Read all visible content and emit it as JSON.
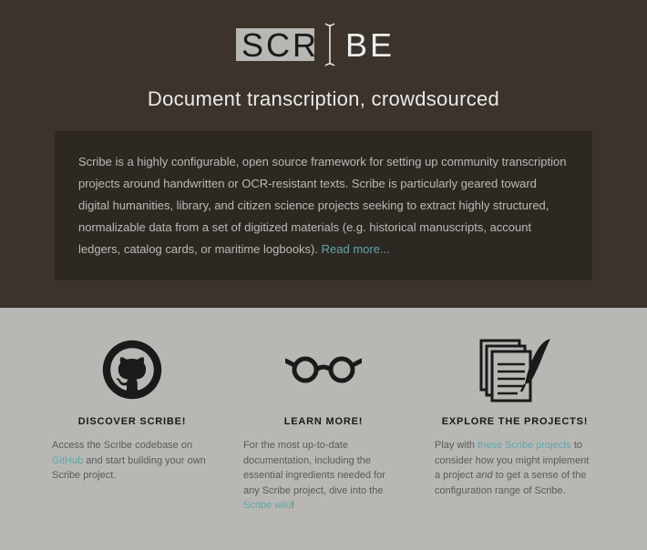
{
  "logo": {
    "text_left": "SCR",
    "text_right": "BE"
  },
  "tagline": "Document transcription, crowdsourced",
  "description": {
    "body": "Scribe is a highly configurable, open source framework for setting up community transcription projects around handwritten or OCR-resistant texts. Scribe is particularly geared toward digital humanities, library, and citizen science projects seeking to extract highly structured, normalizable data from a set of digitized materials (e.g. historical manuscripts, account ledgers, catalog cards, or maritime logbooks).  ",
    "read_more": "Read more..."
  },
  "cards": {
    "discover": {
      "heading": "DISCOVER SCRIBE!",
      "pre": "Access the Scribe codebase on ",
      "link": "GitHub",
      "post": " and start building your own Scribe project."
    },
    "learn": {
      "heading": "LEARN MORE!",
      "pre": "For the most up-to-date documentation, including the essential ingredients needed for any Scribe project, dive into the ",
      "link": "Scribe wiki",
      "post": "!"
    },
    "explore": {
      "heading": "EXPLORE THE PROJECTS!",
      "pre": "Play with ",
      "link": "these Scribe projects",
      "mid": " to consider how you might implement a project ",
      "and": "and",
      "post": " to get a sense of the configuration range of Scribe."
    }
  },
  "colors": {
    "hero_bg": "#3c332c",
    "desc_bg": "#2e2823",
    "accent": "#5da7a9",
    "lower_bg": "#b8b7b3"
  }
}
